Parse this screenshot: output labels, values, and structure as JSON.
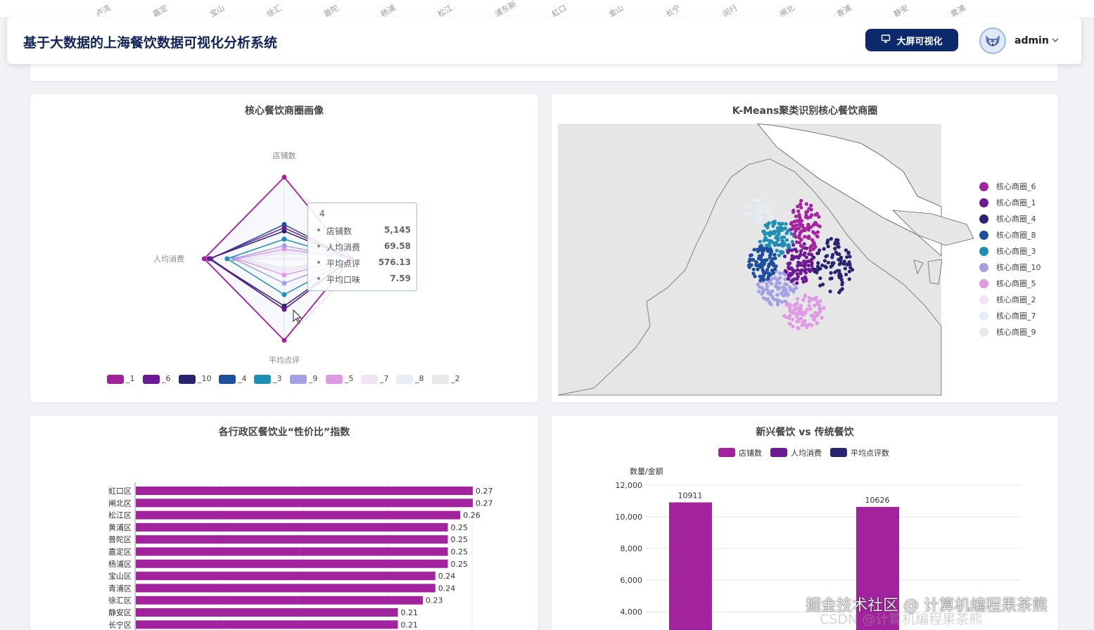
{
  "top_strip": [
    "卢湾",
    "嘉定",
    "宝山",
    "徐汇",
    "普陀",
    "杨浦",
    "松江",
    "浦东新",
    "虹口",
    "金山",
    "长宁",
    "闵行",
    "闸北",
    "青浦",
    "静安",
    "黄浦"
  ],
  "header": {
    "title": "基于大数据的上海餐饮数据可视化分析系统",
    "bigscreen_label": "大屏可视化",
    "username": "admin"
  },
  "radar": {
    "title": "核心餐饮商圈画像",
    "indicators": [
      "店铺数",
      "平均口味",
      "平均点评",
      "人均消费"
    ],
    "legend": [
      "_1",
      "_6",
      "_10",
      "_4",
      "_3",
      "_9",
      "_5",
      "_7",
      "_8",
      "_2"
    ],
    "colors": [
      "#a3239f",
      "#6c1a94",
      "#2a2470",
      "#1c4f9d",
      "#1d8fb4",
      "#a4a0e6",
      "#df9ae6",
      "#f1e3f4",
      "#e5edf9",
      "#e8e8e8"
    ],
    "tooltip": {
      "title": "4",
      "rows": [
        {
          "k": "店铺数",
          "v": "5,145"
        },
        {
          "k": "人均消费",
          "v": "69.58"
        },
        {
          "k": "平均点评",
          "v": "576.13"
        },
        {
          "k": "平均口味",
          "v": "7.59"
        }
      ]
    }
  },
  "map": {
    "title": "K-Means聚类识别核心餐饮商圈",
    "legend": [
      {
        "name": "核心商圈_6",
        "color": "#a3239f"
      },
      {
        "name": "核心商圈_1",
        "color": "#6c1a94"
      },
      {
        "name": "核心商圈_4",
        "color": "#2a2470"
      },
      {
        "name": "核心商圈_8",
        "color": "#1c4f9d"
      },
      {
        "name": "核心商圈_3",
        "color": "#1d8fb4"
      },
      {
        "name": "核心商圈_10",
        "color": "#a4a0e6"
      },
      {
        "name": "核心商圈_5",
        "color": "#df9ae6"
      },
      {
        "name": "核心商圈_2",
        "color": "#f1e3f4"
      },
      {
        "name": "核心商圈_7",
        "color": "#e5edf9"
      },
      {
        "name": "核心商圈_9",
        "color": "#e8e8e8"
      }
    ]
  },
  "chart_data": [
    {
      "type": "bar",
      "title": "各行政区餐饮业“性价比”指数",
      "orientation": "horizontal",
      "categories": [
        "虹口区",
        "闸北区",
        "松江区",
        "黄浦区",
        "普陀区",
        "嘉定区",
        "杨浦区",
        "宝山区",
        "青浦区",
        "徐汇区",
        "静安区",
        "长宁区"
      ],
      "values": [
        0.27,
        0.27,
        0.26,
        0.25,
        0.25,
        0.25,
        0.25,
        0.24,
        0.24,
        0.23,
        0.21,
        0.21
      ],
      "value_labels": [
        "0.27",
        "0.27",
        "0.26",
        "0.25",
        "0.25",
        "0.25",
        "0.25",
        "0.24",
        "0.24",
        "0.23",
        "0.21",
        "0.21"
      ],
      "xlim": [
        0,
        0.27
      ],
      "color": "#a3239f"
    },
    {
      "type": "bar",
      "title": "新兴餐饮 vs 传统餐饮",
      "ylabel": "数量/金额",
      "series": [
        {
          "name": "店铺数",
          "values": [
            10911,
            10626
          ],
          "labels": [
            "10911",
            "10626"
          ],
          "color": "#a3239f"
        },
        {
          "name": "人均消费",
          "values": [],
          "color": "#6c1a94"
        },
        {
          "name": "平均点评数",
          "values": [],
          "color": "#2a2470"
        }
      ],
      "y_ticks": [
        "12,000",
        "10,000",
        "8,000",
        "6,000",
        "4,000"
      ],
      "y_tick_values": [
        12000,
        10000,
        8000,
        6000,
        4000
      ],
      "ylim": [
        4000,
        12000
      ]
    }
  ],
  "watermark": {
    "text": "掘金技术社区 @ 计算机编程果茶熊",
    "text2": "CSDN @计算机编程果茶熊"
  }
}
